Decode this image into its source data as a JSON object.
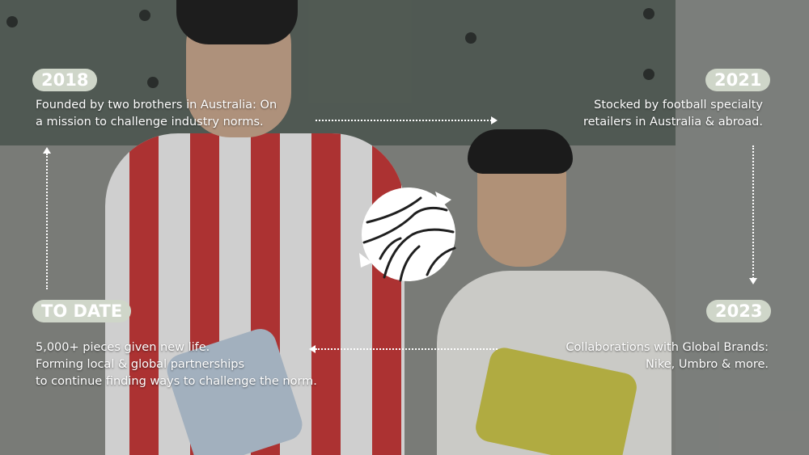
{
  "timeline": [
    {
      "year": "2018",
      "text_line1": "Founded by two brothers in Australia: On",
      "text_line2": "a mission to challenge industry norms."
    },
    {
      "year": "2021",
      "text_line1": "Stocked by football specialty",
      "text_line2": "retailers in Australia & abroad."
    },
    {
      "year": "2023",
      "text_line1": "Collaborations with Global Brands:",
      "text_line2": "Nike, Umbro & more."
    },
    {
      "year": "TO DATE",
      "text_line1": "5,000+ pieces given new life.",
      "text_line2": "Forming local & global partnerships",
      "text_line3": "to continue finding ways to challenge the norm."
    }
  ],
  "center_icon": "football-icon",
  "colors": {
    "badge_bg": "#cfd6c9",
    "text": "#ffffff"
  }
}
